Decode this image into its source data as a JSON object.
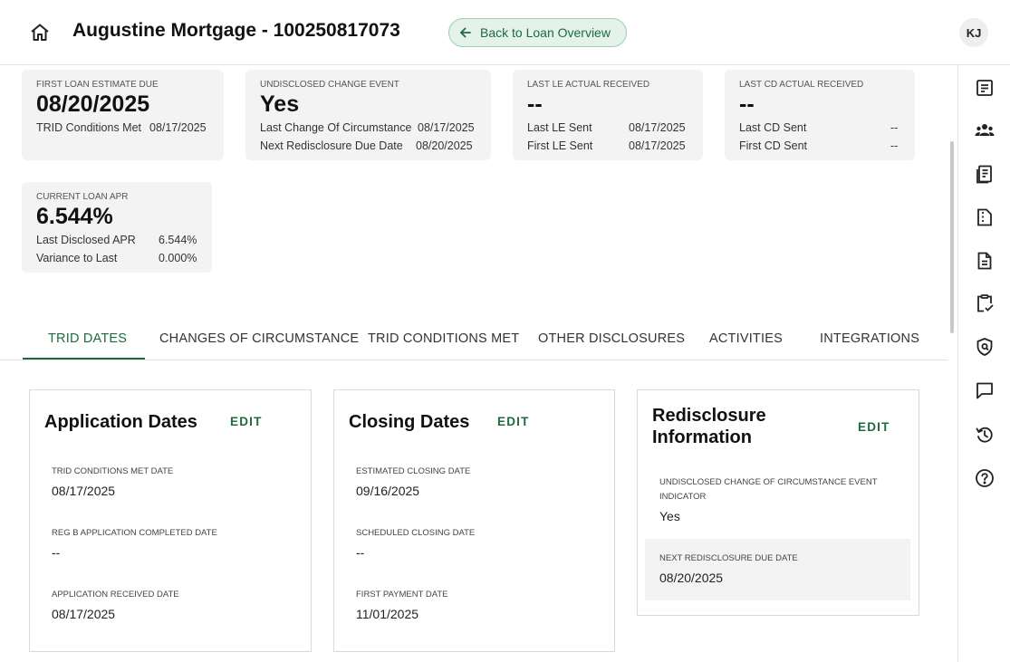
{
  "header": {
    "title": "Augustine Mortgage - 100250817073",
    "back_label": "Back to Loan Overview",
    "avatar_initials": "KJ"
  },
  "cards": {
    "first_le": {
      "label": "FIRST LOAN ESTIMATE DUE",
      "value": "08/20/2025",
      "rows": [
        {
          "label": "TRID Conditions Met",
          "value": "08/17/2025"
        }
      ]
    },
    "undisclosed": {
      "label": "UNDISCLOSED CHANGE EVENT",
      "value": "Yes",
      "rows": [
        {
          "label": "Last Change Of Circumstance",
          "value": "08/17/2025"
        },
        {
          "label": "Next Redisclosure Due Date",
          "value": "08/20/2025"
        }
      ]
    },
    "last_le": {
      "label": "LAST LE ACTUAL RECEIVED",
      "value": "--",
      "rows": [
        {
          "label": "Last LE Sent",
          "value": "08/17/2025"
        },
        {
          "label": "First LE Sent",
          "value": "08/17/2025"
        }
      ]
    },
    "last_cd": {
      "label": "LAST CD ACTUAL RECEIVED",
      "value": "--",
      "rows": [
        {
          "label": "Last CD Sent",
          "value": "--"
        },
        {
          "label": "First CD Sent",
          "value": "--"
        }
      ]
    },
    "apr": {
      "label": "CURRENT LOAN APR",
      "value": "6.544%",
      "rows": [
        {
          "label": "Last Disclosed APR",
          "value": "6.544%"
        },
        {
          "label": "Variance to Last",
          "value": "0.000%"
        }
      ]
    }
  },
  "tabs": [
    {
      "label": "TRID DATES",
      "active": true
    },
    {
      "label": "CHANGES OF CIRCUMSTANCE"
    },
    {
      "label": "TRID CONDITIONS MET"
    },
    {
      "label": "OTHER DISCLOSURES"
    },
    {
      "label": "ACTIVITIES"
    },
    {
      "label": "INTEGRATIONS"
    }
  ],
  "panels": {
    "application": {
      "title": "Application Dates",
      "edit": "EDIT",
      "fields": [
        {
          "label": "TRID CONDITIONS MET DATE",
          "value": "08/17/2025"
        },
        {
          "label": "REG B APPLICATION COMPLETED DATE",
          "value": "--"
        },
        {
          "label": "APPLICATION RECEIVED DATE",
          "value": "08/17/2025"
        }
      ]
    },
    "closing": {
      "title": "Closing Dates",
      "edit": "EDIT",
      "fields": [
        {
          "label": "ESTIMATED CLOSING DATE",
          "value": "09/16/2025"
        },
        {
          "label": "SCHEDULED CLOSING DATE",
          "value": "--"
        },
        {
          "label": "FIRST PAYMENT DATE",
          "value": "11/01/2025"
        }
      ]
    },
    "redisclosure": {
      "title_line1": "Redisclosure",
      "title_line2": "Information",
      "edit": "EDIT",
      "fields": [
        {
          "label_line1": "UNDISCLOSED CHANGE OF CIRCUMSTANCE EVENT",
          "label_line2": "INDICATOR",
          "value": "Yes"
        },
        {
          "label": "NEXT REDISCLOSURE DUE DATE",
          "value": "08/20/2025"
        }
      ]
    }
  },
  "rail_icons": [
    "summary-icon",
    "borrowers-icon",
    "loan-docs-icon",
    "disclosure-icon",
    "document-icon",
    "conditions-checklist-icon",
    "compliance-shield-icon",
    "messages-icon",
    "history-icon",
    "help-icon"
  ],
  "colors": {
    "accent": "#1d6b40",
    "card_bg": "#f3f3f3",
    "back_btn_bg": "#e4f2e9"
  }
}
